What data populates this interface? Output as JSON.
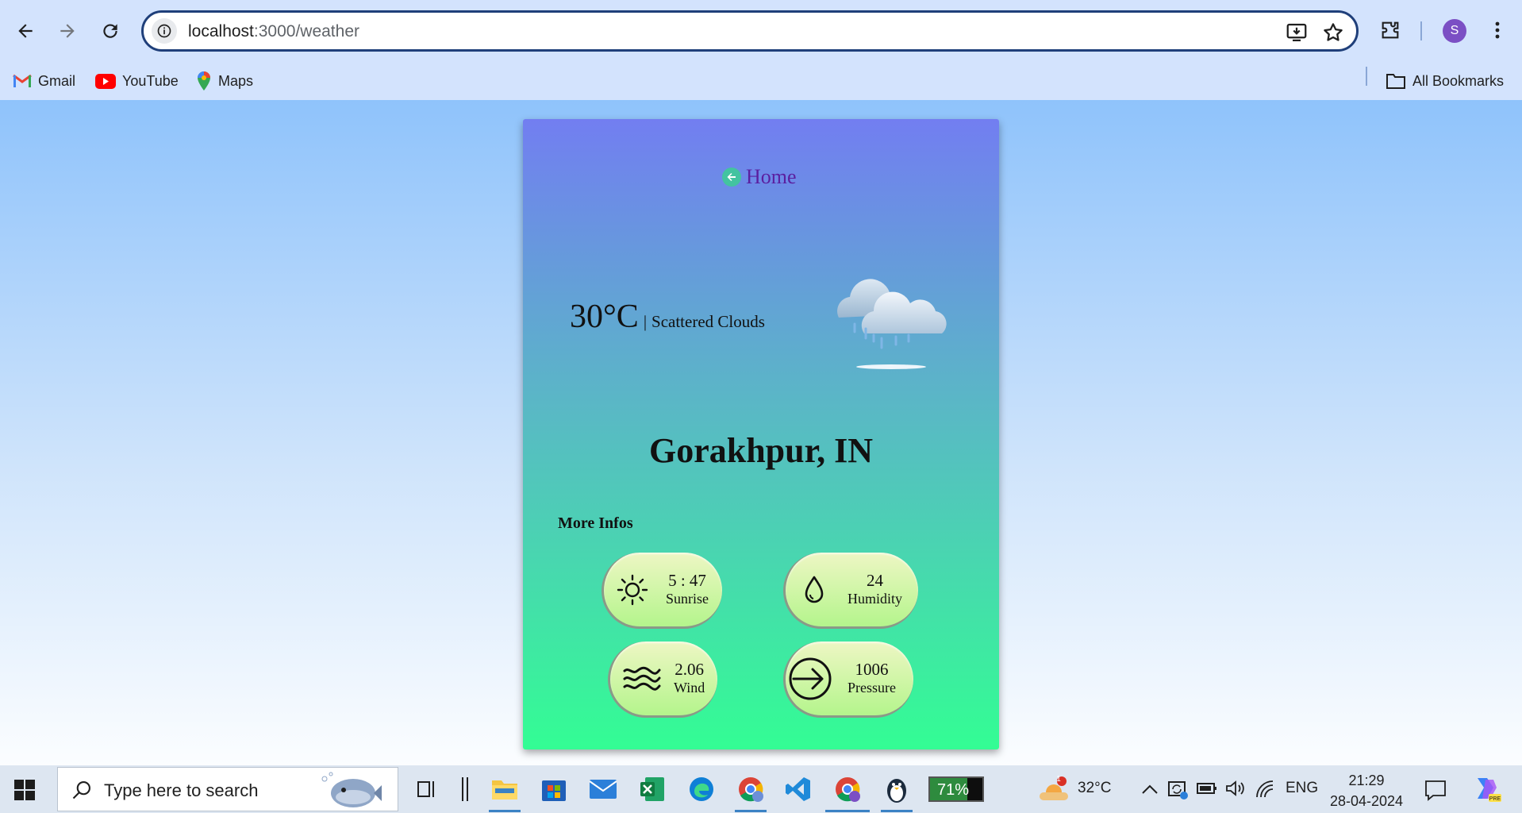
{
  "browser": {
    "url_host": "localhost",
    "url_path": ":3000/weather",
    "profile_initial": "S",
    "bookmarks": [
      {
        "label": "Gmail",
        "icon": "gmail-icon"
      },
      {
        "label": "YouTube",
        "icon": "youtube-icon"
      },
      {
        "label": "Maps",
        "icon": "maps-icon"
      }
    ],
    "all_bookmarks_label": "All Bookmarks"
  },
  "weather": {
    "home_label": "Home",
    "temperature": "30°C",
    "separator": "|",
    "description": "Scattered Clouds",
    "city": "Gorakhpur, IN",
    "more_infos_label": "More Infos",
    "details": {
      "sunrise": {
        "value": "5 : 47",
        "label": "Sunrise",
        "icon": "sun-icon"
      },
      "humidity": {
        "value": "24",
        "label": "Humidity",
        "icon": "droplet-icon"
      },
      "wind": {
        "value": "2.06",
        "label": "Wind",
        "icon": "wind-icon"
      },
      "pressure": {
        "value": "1006",
        "label": "Pressure",
        "icon": "arrow-circle-icon"
      }
    }
  },
  "taskbar": {
    "search_placeholder": "Type here to search",
    "battery_percent": "71%",
    "battery_level": 0.71,
    "weather_temp": "32°C",
    "weather_badge": "1",
    "language": "ENG",
    "time": "21:29",
    "date": "28-04-2024"
  },
  "colors": {
    "card_top": "#727ef1",
    "card_bottom": "#33fd94",
    "home_link": "#5b1fa0",
    "pill_bottom": "#b4f58c"
  }
}
